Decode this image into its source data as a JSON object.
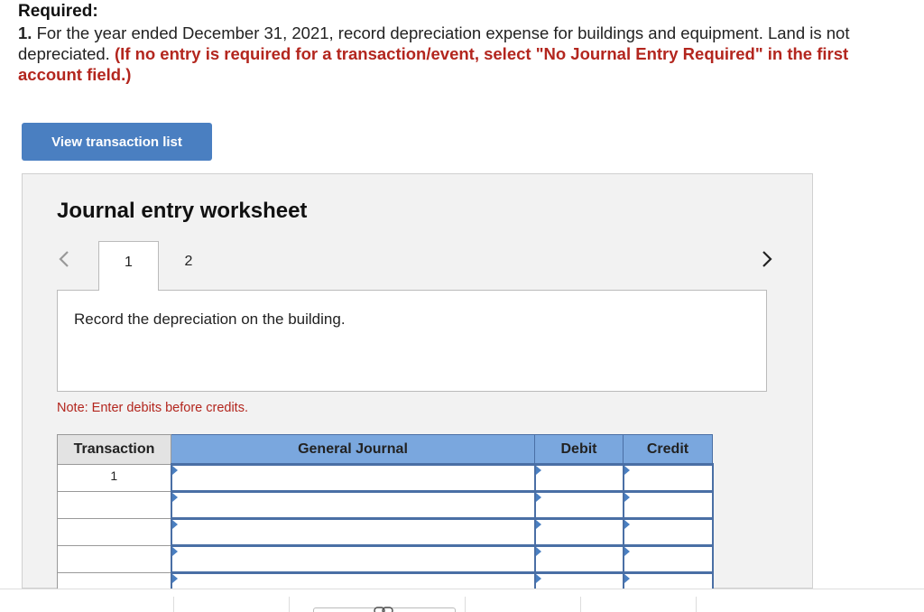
{
  "required": {
    "heading": "Required:"
  },
  "instructions": {
    "number": "1.",
    "text": " For the year ended December 31, 2021, record depreciation expense for buildings and equipment. Land is not depreciated. ",
    "hint": "(If no entry is required for a transaction/event, select \"No Journal Entry Required\" in the first account field.)"
  },
  "view_button": {
    "label": "View transaction list"
  },
  "worksheet": {
    "title": "Journal entry worksheet",
    "tabs": [
      {
        "label": "1",
        "active": true
      },
      {
        "label": "2",
        "active": false
      }
    ],
    "description": "Record the depreciation on the building.",
    "note": "Note: Enter debits before credits.",
    "nav": {
      "prev_icon": "chevron-left-icon",
      "next_icon": "chevron-right-icon"
    }
  },
  "journal_table": {
    "columns": [
      "Transaction",
      "General Journal",
      "Debit",
      "Credit"
    ],
    "rows": [
      {
        "transaction": "1",
        "account": "",
        "debit": "",
        "credit": ""
      },
      {
        "transaction": "",
        "account": "",
        "debit": "",
        "credit": ""
      },
      {
        "transaction": "",
        "account": "",
        "debit": "",
        "credit": ""
      },
      {
        "transaction": "",
        "account": "",
        "debit": "",
        "credit": ""
      },
      {
        "transaction": "",
        "account": "",
        "debit": "",
        "credit": ""
      }
    ]
  },
  "colors": {
    "button": "#4a7fc1",
    "header": "#7aa7de",
    "hint": "#b3261e"
  },
  "bottom_bar": {
    "icon": "link-icon"
  }
}
